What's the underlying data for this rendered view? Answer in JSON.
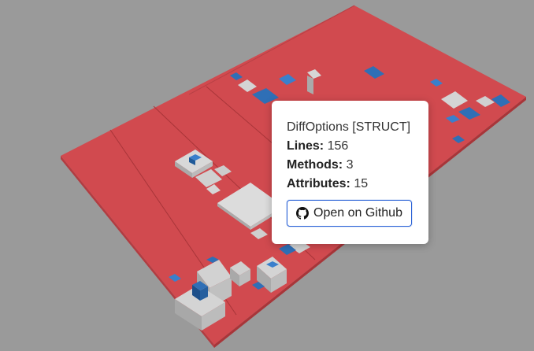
{
  "viewer": {
    "background_color": "#9a9a9a",
    "plate_color": "#d14a4f",
    "building_color": "#d3d3d3",
    "method_color": "#2f6fb6"
  },
  "tooltip": {
    "title": "DiffOptions [STRUCT]",
    "lines_label": "Lines:",
    "lines_value": "156",
    "methods_label": "Methods:",
    "methods_value": "3",
    "attributes_label": "Attributes:",
    "attributes_value": "15",
    "github_button_label": "Open on Github",
    "github_icon": "github-icon"
  }
}
